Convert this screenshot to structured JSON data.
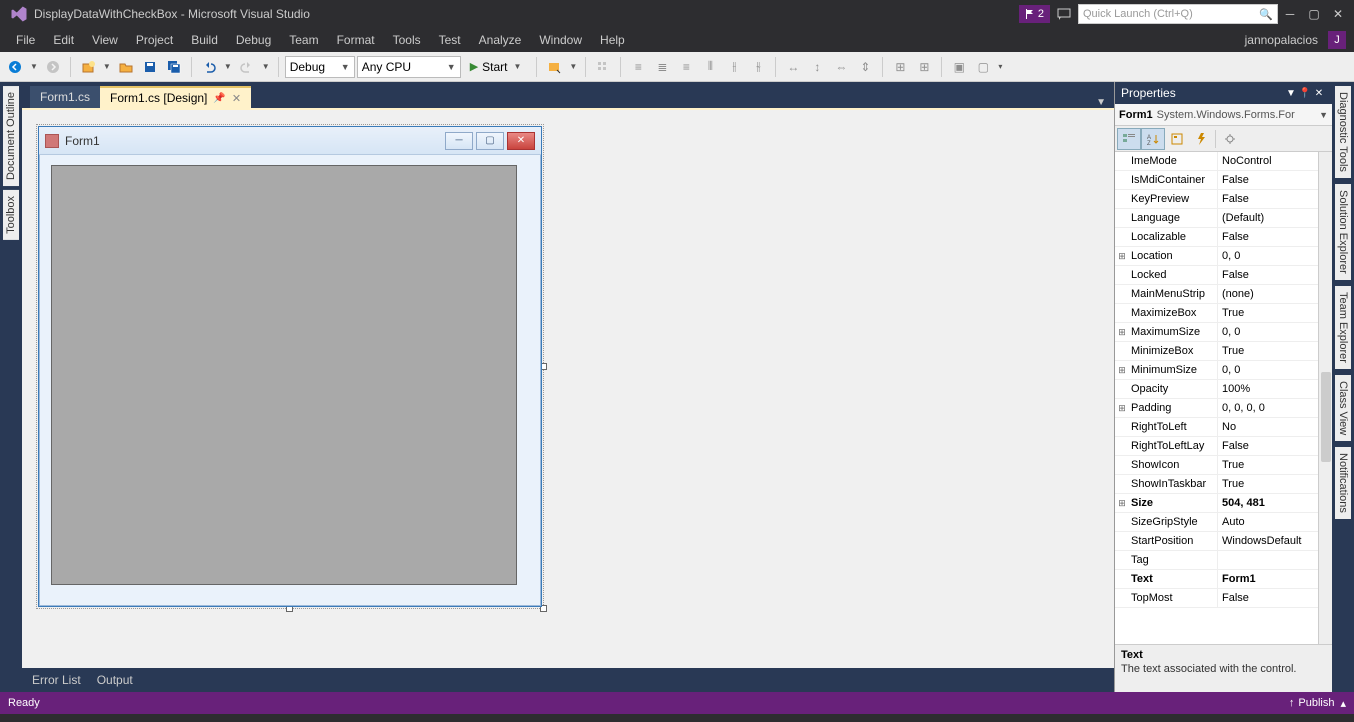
{
  "title": "DisplayDataWithCheckBox - Microsoft Visual Studio",
  "quicklaunch_placeholder": "Quick Launch (Ctrl+Q)",
  "notification_count": "2",
  "menu": [
    "File",
    "Edit",
    "View",
    "Project",
    "Build",
    "Debug",
    "Team",
    "Format",
    "Tools",
    "Test",
    "Analyze",
    "Window",
    "Help"
  ],
  "username": "jannopalacios",
  "user_initial": "J",
  "toolbar": {
    "config": "Debug",
    "platform": "Any CPU",
    "start": "Start"
  },
  "left_dock": [
    "Document Outline",
    "Toolbox"
  ],
  "right_dock": [
    "Diagnostic Tools",
    "Solution Explorer",
    "Team Explorer",
    "Class View",
    "Notifications"
  ],
  "tabs": [
    {
      "label": "Form1.cs",
      "active": false
    },
    {
      "label": "Form1.cs [Design]",
      "active": true
    }
  ],
  "form": {
    "title": "Form1"
  },
  "bottom_tabs": [
    "Error List",
    "Output"
  ],
  "properties": {
    "panel_title": "Properties",
    "object_name": "Form1",
    "object_type": "System.Windows.Forms.For",
    "rows": [
      {
        "exp": "",
        "name": "ImeMode",
        "val": "NoControl",
        "bold": false
      },
      {
        "exp": "",
        "name": "IsMdiContainer",
        "val": "False",
        "bold": false
      },
      {
        "exp": "",
        "name": "KeyPreview",
        "val": "False",
        "bold": false
      },
      {
        "exp": "",
        "name": "Language",
        "val": "(Default)",
        "bold": false
      },
      {
        "exp": "",
        "name": "Localizable",
        "val": "False",
        "bold": false
      },
      {
        "exp": "⊞",
        "name": "Location",
        "val": "0, 0",
        "bold": false
      },
      {
        "exp": "",
        "name": "Locked",
        "val": "False",
        "bold": false
      },
      {
        "exp": "",
        "name": "MainMenuStrip",
        "val": "(none)",
        "bold": false
      },
      {
        "exp": "",
        "name": "MaximizeBox",
        "val": "True",
        "bold": false
      },
      {
        "exp": "⊞",
        "name": "MaximumSize",
        "val": "0, 0",
        "bold": false
      },
      {
        "exp": "",
        "name": "MinimizeBox",
        "val": "True",
        "bold": false
      },
      {
        "exp": "⊞",
        "name": "MinimumSize",
        "val": "0, 0",
        "bold": false
      },
      {
        "exp": "",
        "name": "Opacity",
        "val": "100%",
        "bold": false
      },
      {
        "exp": "⊞",
        "name": "Padding",
        "val": "0, 0, 0, 0",
        "bold": false
      },
      {
        "exp": "",
        "name": "RightToLeft",
        "val": "No",
        "bold": false
      },
      {
        "exp": "",
        "name": "RightToLeftLay",
        "val": "False",
        "bold": false
      },
      {
        "exp": "",
        "name": "ShowIcon",
        "val": "True",
        "bold": false
      },
      {
        "exp": "",
        "name": "ShowInTaskbar",
        "val": "True",
        "bold": false
      },
      {
        "exp": "⊞",
        "name": "Size",
        "val": "504, 481",
        "bold": true
      },
      {
        "exp": "",
        "name": "SizeGripStyle",
        "val": "Auto",
        "bold": false
      },
      {
        "exp": "",
        "name": "StartPosition",
        "val": "WindowsDefault",
        "bold": false
      },
      {
        "exp": "",
        "name": "Tag",
        "val": "",
        "bold": false
      },
      {
        "exp": "",
        "name": "Text",
        "val": "Form1",
        "bold": true
      },
      {
        "exp": "",
        "name": "TopMost",
        "val": "False",
        "bold": false
      }
    ],
    "desc_title": "Text",
    "desc_text": "The text associated with the control."
  },
  "status": {
    "ready": "Ready",
    "publish": "Publish"
  }
}
